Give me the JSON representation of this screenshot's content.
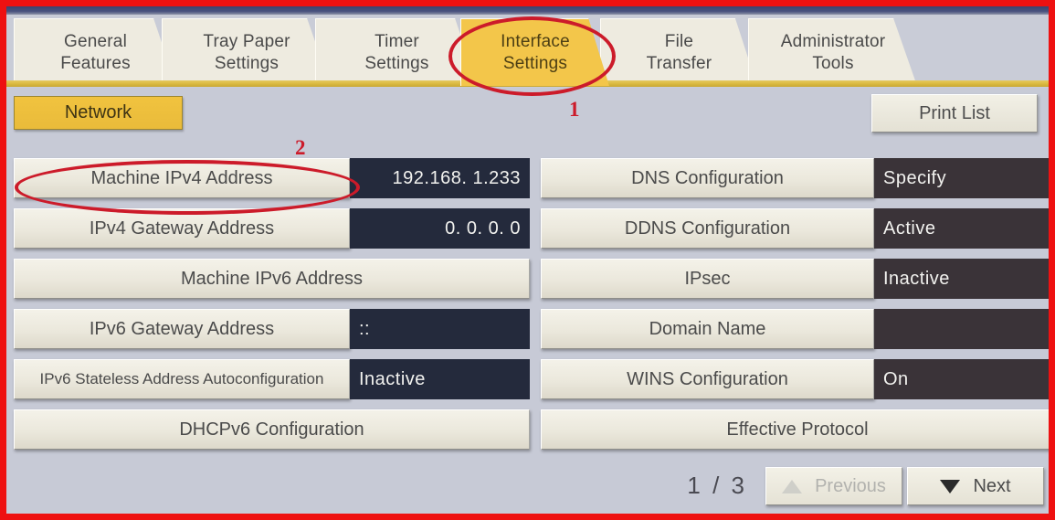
{
  "tabs": [
    {
      "line1": "General",
      "line2": "Features",
      "active": false
    },
    {
      "line1": "Tray Paper",
      "line2": "Settings",
      "active": false
    },
    {
      "line1": "Timer",
      "line2": "Settings",
      "active": false
    },
    {
      "line1": "Interface",
      "line2": "Settings",
      "active": true
    },
    {
      "line1": "File",
      "line2": "Transfer",
      "active": false
    },
    {
      "line1": "Administrator",
      "line2": "Tools",
      "active": false
    }
  ],
  "subheader": {
    "network_label": "Network",
    "print_list_label": "Print List"
  },
  "left_column": [
    {
      "label": "Machine IPv4 Address",
      "value": "192.168.   1.233",
      "has_value": true,
      "align": "right"
    },
    {
      "label": "IPv4 Gateway Address",
      "value": "0.   0.   0.   0",
      "has_value": true,
      "align": "right"
    },
    {
      "label": "Machine IPv6 Address",
      "value": "",
      "has_value": false,
      "align": "right"
    },
    {
      "label": "IPv6 Gateway Address",
      "value": "::",
      "has_value": true,
      "align": "left"
    },
    {
      "label": "IPv6 Stateless Address Autoconfiguration",
      "value": "Inactive",
      "has_value": true,
      "align": "left"
    },
    {
      "label": "DHCPv6 Configuration",
      "value": "",
      "has_value": false,
      "align": "left"
    }
  ],
  "right_column": [
    {
      "label": "DNS Configuration",
      "value": "Specify",
      "has_value": true,
      "align": "left"
    },
    {
      "label": "DDNS Configuration",
      "value": "Active",
      "has_value": true,
      "align": "left"
    },
    {
      "label": "IPsec",
      "value": "Inactive",
      "has_value": true,
      "align": "left"
    },
    {
      "label": "Domain Name",
      "value": "",
      "has_value": true,
      "align": "left"
    },
    {
      "label": "WINS Configuration",
      "value": "On",
      "has_value": true,
      "align": "left"
    },
    {
      "label": "Effective Protocol",
      "value": "",
      "has_value": false,
      "align": "left"
    }
  ],
  "footer": {
    "page_indicator": "1 / 3",
    "previous_label": "Previous",
    "next_label": "Next"
  },
  "annotations": {
    "marker_1": "1",
    "marker_2": "2"
  },
  "colors": {
    "annotation_red": "#cc1b2a",
    "active_tab_gold": "#f3c64a",
    "screen_background": "#c7cad6",
    "value_box_navy": "#242a3c",
    "value_box_warm": "#3a3338"
  }
}
